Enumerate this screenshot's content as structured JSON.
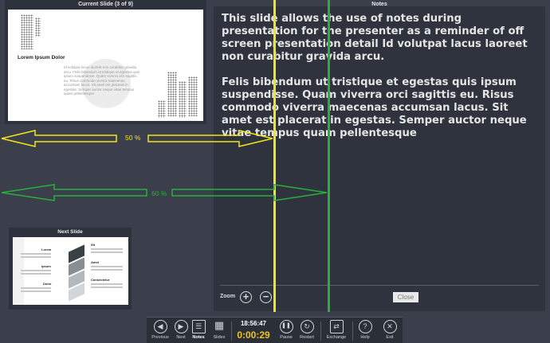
{
  "current_slide": {
    "panel_title": "Current Slide (3 of 9)",
    "heading": "Lorem Ipsum Dolor",
    "body": "Id volutpat lacus laoreet non curabitur gravida arcu. Felis bibendum ut tristique et egestas quis ipsum suspendisse. Quam viverra orci sagittis eu. Risus commodo viverra maecenas accumsan lacus. Sit amet est placerat in egestas. Semper auctor neque vitae tempus quam pellentesque"
  },
  "notes": {
    "panel_title": "Notes",
    "paragraph1": "This slide allows the use of notes during presentation for the presenter as a reminder of off screen presentation detail Id volutpat lacus laoreet non curabitur gravida arcu.",
    "paragraph2": "Felis bibendum ut tristique et egestas quis ipsum suspendisse. Quam viverra orci sagittis eu. Risus commodo viverra maecenas accumsan lacus. Sit amet est placerat in egestas. Semper auctor neque vitae tempus quam pellentesque",
    "zoom_label": "Zoom",
    "zoom_in_icon": "plus-circle-icon",
    "zoom_out_icon": "minus-circle-icon",
    "close_label": "Close"
  },
  "next_slide": {
    "panel_title": "Next Slide",
    "labels_left": [
      "Lorem",
      "Ipsum",
      "Dolor"
    ],
    "labels_right": [
      "Sit",
      "Amet",
      "Consectetur"
    ]
  },
  "overlays": {
    "yellow_label": "50 %",
    "green_label": "60 %",
    "yellow_color": "#f2e41c",
    "green_color": "#27b03a"
  },
  "toolbar": {
    "previous": "Previous",
    "next": "Next",
    "notes": "Notes",
    "slides": "Slides",
    "clock": "18:56:47",
    "timer": "0:00:29",
    "pause": "Pause",
    "restart": "Restart",
    "exchange": "Exchange",
    "help": "Help",
    "exit": "Exit",
    "timer_color": "#f0c419"
  }
}
